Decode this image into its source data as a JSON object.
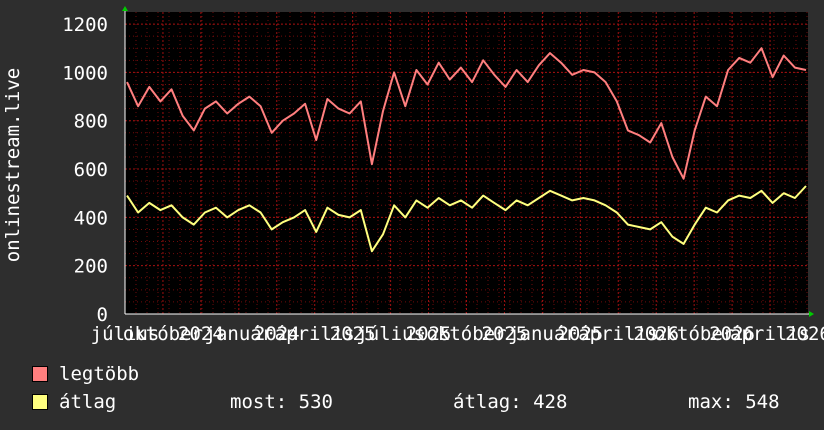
{
  "side_label": "onlinestream.live",
  "legend": {
    "items": [
      {
        "label": "legtöbb",
        "color": "#ff7f7f"
      },
      {
        "label": "átlag",
        "color": "#ffff7f"
      }
    ],
    "stats": {
      "now": "most: 530",
      "avg": "átlag: 428",
      "max": "max: 548"
    }
  },
  "colors": {
    "background": "#2e2e2e",
    "plot": "#000000",
    "grid": "#a01010",
    "axis": "#ffffff",
    "arrow": "#00cc00"
  },
  "chart_data": {
    "type": "line",
    "ylim": [
      0,
      1250
    ],
    "yticks": [
      0,
      200,
      400,
      600,
      800,
      1000,
      1200
    ],
    "ytick_labels": [
      "0",
      "200",
      "400",
      "600",
      "800",
      "1000",
      "1200"
    ],
    "xtick_labels": [
      "július",
      "október",
      "2024",
      "január",
      "2024",
      "április",
      "2025",
      "július",
      "2025",
      "október",
      "2025",
      "január",
      "2025",
      "április",
      "2026",
      "október",
      "2026",
      "április",
      "2026"
    ],
    "grid": true,
    "points_per_series": 62,
    "series": [
      {
        "name": "legtöbb",
        "color": "#ff7f7f",
        "values": [
          960,
          860,
          940,
          880,
          930,
          820,
          760,
          850,
          880,
          830,
          870,
          900,
          860,
          750,
          800,
          830,
          870,
          720,
          890,
          850,
          830,
          880,
          620,
          840,
          1000,
          860,
          1010,
          950,
          1040,
          970,
          1020,
          960,
          1050,
          990,
          940,
          1010,
          960,
          1030,
          1080,
          1040,
          990,
          1010,
          1000,
          960,
          880,
          760,
          740,
          710,
          790,
          650,
          560,
          760,
          900,
          860,
          1010,
          1060,
          1040,
          1100,
          980,
          1070,
          1020,
          1010
        ]
      },
      {
        "name": "átlag",
        "color": "#ffff7f",
        "values": [
          490,
          420,
          460,
          430,
          450,
          400,
          370,
          420,
          440,
          400,
          430,
          450,
          420,
          350,
          380,
          400,
          430,
          340,
          440,
          410,
          400,
          430,
          260,
          330,
          450,
          400,
          470,
          440,
          480,
          450,
          470,
          440,
          490,
          460,
          430,
          470,
          450,
          480,
          510,
          490,
          470,
          480,
          470,
          450,
          420,
          370,
          360,
          350,
          380,
          320,
          290,
          370,
          440,
          420,
          470,
          490,
          480,
          510,
          460,
          500,
          480,
          530
        ]
      }
    ]
  }
}
